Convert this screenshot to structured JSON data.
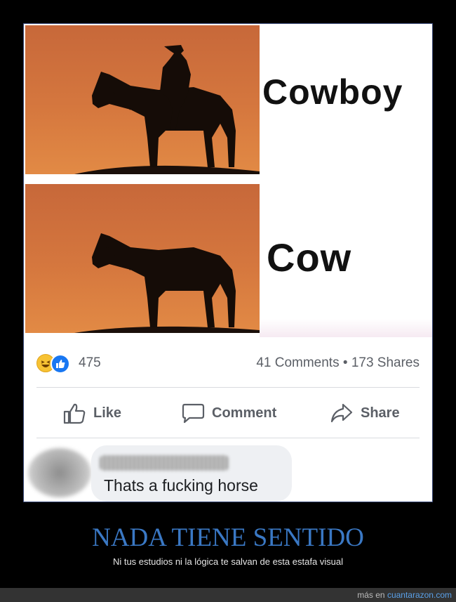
{
  "meme": {
    "label_top": "Cowboy",
    "label_bottom": "Cow"
  },
  "post": {
    "reaction_count": "475",
    "comments": "41 Comments",
    "separator": "•",
    "shares": "173 Shares",
    "actions": {
      "like": "Like",
      "comment": "Comment",
      "share": "Share"
    },
    "comment_text": "Thats a fucking horse"
  },
  "caption": {
    "title": "NADA TIENE SENTIDO",
    "subtitle": "Ni tus estudios ni la lógica te salvan de esta estafa visual"
  },
  "footer": {
    "prefix": "más en",
    "site": "cuantarazon.com"
  },
  "colors": {
    "sunset": "#d5773e",
    "caption_blue": "#3a78c4",
    "like_blue": "#1877f2",
    "haha_yellow": "#f7c233"
  }
}
